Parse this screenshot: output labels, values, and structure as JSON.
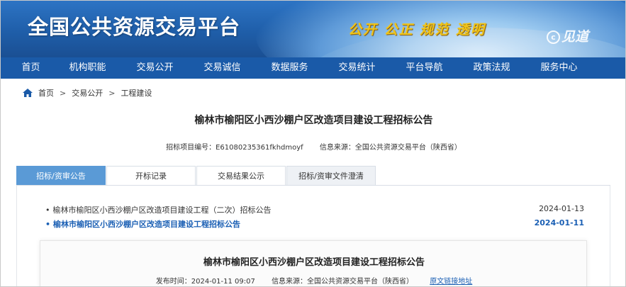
{
  "header": {
    "title": "全国公共资源交易平台",
    "slogan": "公开 公正 规范 透明",
    "watermark": "见道",
    "watermark_mark": "c"
  },
  "nav": {
    "items": [
      "首页",
      "机构职能",
      "交易公开",
      "交易诚信",
      "数据服务",
      "交易统计",
      "平台导航",
      "政策法规",
      "服务中心"
    ]
  },
  "breadcrumb": {
    "icon": "home-icon",
    "items": [
      "首页",
      "交易公开",
      "工程建设"
    ],
    "separator": ">"
  },
  "notice": {
    "title": "榆林市榆阳区小西沙棚户区改造项目建设工程招标公告",
    "project_no": "招标项目编号：E61080235361fkhdmoyf",
    "source": "信息来源：全国公共资源交易平台（陕西省）"
  },
  "tabs": [
    "招标/资审公告",
    "开标记录",
    "交易结果公示",
    "招标/资审文件澄清"
  ],
  "list": [
    {
      "bullet": "•",
      "title": "榆林市榆阳区小西沙棚户区改造项目建设工程（二次）招标公告",
      "date": "2024-01-13"
    },
    {
      "bullet": "•",
      "title": "榆林市榆阳区小西沙棚户区改造项目建设工程招标公告",
      "date": "2024-01-11"
    }
  ],
  "detail": {
    "title": "榆林市榆阳区小西沙棚户区改造项目建设工程招标公告",
    "publish_time": "发布时间：2024-01-11 09:07",
    "source": "信息来源：全国公共资源交易平台（陕西省）",
    "original_link": "原文链接地址"
  },
  "colors": {
    "nav_bg": "#1a5aa8",
    "tab_active": "#5a9ad6",
    "link": "#1a5fb4",
    "slogan": "#f0c419"
  }
}
